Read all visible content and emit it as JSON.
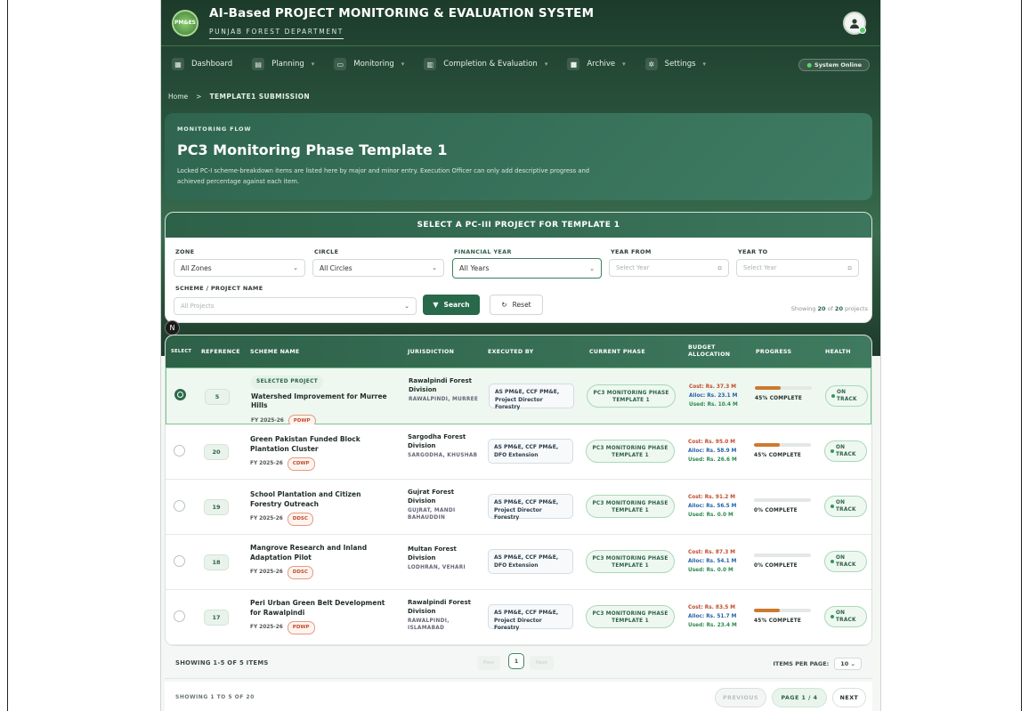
{
  "app": {
    "logo_text": "PM&ES",
    "title": "AI-Based PROJECT MONITORING & EVALUATION SYSTEM",
    "subtitle": "PUNJAB FOREST DEPARTMENT"
  },
  "nav": {
    "items": [
      {
        "label": "Dashboard",
        "icon": "grid-icon"
      },
      {
        "label": "Planning",
        "icon": "clipboard-icon"
      },
      {
        "label": "Monitoring",
        "icon": "monitor-icon"
      },
      {
        "label": "Completion & Evaluation",
        "icon": "chart-icon"
      },
      {
        "label": "Archive",
        "icon": "archive-icon"
      },
      {
        "label": "Settings",
        "icon": "gear-icon"
      }
    ],
    "status": "System Online"
  },
  "breadcrumb": {
    "home": "Home",
    "sep": ">",
    "current": "TEMPLATE1 SUBMISSION"
  },
  "hero": {
    "kicker": "MONITORING FLOW",
    "title": "PC3 Monitoring Phase Template 1",
    "description": "Locked PC-I scheme-breakdown items are listed here by major and minor entry. Execution Officer can only add descriptive progress and achieved percentage against each item."
  },
  "filters": {
    "header": "SELECT A PC-III PROJECT FOR TEMPLATE 1",
    "zone_label": "ZONE",
    "zone_value": "All Zones",
    "circle_label": "CIRCLE",
    "circle_value": "All Circles",
    "fy_label": "FINANCIAL YEAR",
    "fy_value": "All Years",
    "year_from_label": "YEAR FROM",
    "year_from_placeholder": "Select Year",
    "year_to_label": "YEAR TO",
    "year_to_placeholder": "Select Year",
    "scheme_label": "SCHEME / PROJECT NAME",
    "scheme_placeholder": "All Projects",
    "search_label": "Search",
    "reset_label": "Reset",
    "showing_prefix": "Showing",
    "showing_count": "20",
    "showing_of": "of",
    "showing_total": "20",
    "showing_suffix": "projects"
  },
  "table": {
    "headers": [
      "SELECT",
      "REFERENCE",
      "SCHEME NAME",
      "JURISDICTION",
      "EXECUTED BY",
      "CURRENT PHASE",
      "BUDGET ALLOCATION",
      "PROGRESS",
      "HEALTH"
    ],
    "selected_pill": "SELECTED PROJECT",
    "rows": [
      {
        "selected": true,
        "ref": "5",
        "name": "Watershed Improvement for Murree Hills",
        "fy": "FY 2025-26",
        "tag": "PDWP",
        "jur": "Rawalpindi Forest Division",
        "jur_sub": "RAWALPINDI, MURREE",
        "exec": "AS PM&E, CCF PM&E, Project Director Forestry",
        "phase": "PC3 MONITORING PHASE TEMPLATE 1",
        "cost": "Cost: Rs. 37.3 M",
        "alloc": "Alloc: Rs. 23.1 M",
        "used": "Used: Rs. 10.4 M",
        "progress": 45,
        "progress_text": "45% COMPLETE",
        "health": "ON TRACK"
      },
      {
        "selected": false,
        "ref": "20",
        "name": "Green Pakistan Funded Block Plantation Cluster",
        "fy": "FY 2025-26",
        "tag": "CDWP",
        "jur": "Sargodha Forest Division",
        "jur_sub": "SARGODHA, KHUSHAB",
        "exec": "AS PM&E, CCF PM&E, DFO Extension",
        "phase": "PC3 MONITORING PHASE TEMPLATE 1",
        "cost": "Cost: Rs. 95.0 M",
        "alloc": "Alloc: Rs. 58.9 M",
        "used": "Used: Rs. 26.6 M",
        "progress": 45,
        "progress_text": "45% COMPLETE",
        "health": "ON TRACK"
      },
      {
        "selected": false,
        "ref": "19",
        "name": "School Plantation and Citizen Forestry Outreach",
        "fy": "FY 2025-26",
        "tag": "DDSC",
        "jur": "Gujrat Forest Division",
        "jur_sub": "GUJRAT, MANDI BAHAUDDIN",
        "exec": "AS PM&E, CCF PM&E, Project Director Forestry",
        "phase": "PC3 MONITORING PHASE TEMPLATE 1",
        "cost": "Cost: Rs. 91.2 M",
        "alloc": "Alloc: Rs. 56.5 M",
        "used": "Used: Rs. 0.0 M",
        "progress": 0,
        "progress_text": "0% COMPLETE",
        "health": "ON TRACK"
      },
      {
        "selected": false,
        "ref": "18",
        "name": "Mangrove Research and Inland Adaptation Pilot",
        "fy": "FY 2025-26",
        "tag": "DDSC",
        "jur": "Multan Forest Division",
        "jur_sub": "LODHRAN, VEHARI",
        "exec": "AS PM&E, CCF PM&E, DFO Extension",
        "phase": "PC3 MONITORING PHASE TEMPLATE 1",
        "cost": "Cost: Rs. 87.3 M",
        "alloc": "Alloc: Rs. 54.1 M",
        "used": "Used: Rs. 0.0 M",
        "progress": 0,
        "progress_text": "0% COMPLETE",
        "health": "ON TRACK"
      },
      {
        "selected": false,
        "ref": "17",
        "name": "Peri Urban Green Belt Development for Rawalpindi",
        "fy": "FY 2025-26",
        "tag": "PDWP",
        "jur": "Rawalpindi Forest Division",
        "jur_sub": "RAWALPINDI, ISLAMABAD",
        "exec": "AS PM&E, CCF PM&E, Project Director Forestry",
        "phase": "PC3 MONITORING PHASE TEMPLATE 1",
        "cost": "Cost: Rs. 83.5 M",
        "alloc": "Alloc: Rs. 51.7 M",
        "used": "Used: Rs. 23.4 M",
        "progress": 45,
        "progress_text": "45% COMPLETE",
        "health": "ON TRACK"
      }
    ]
  },
  "pagination": {
    "items_text": "SHOWING 1-5 OF 5 ITEMS",
    "prev": "Prev",
    "current": "1",
    "next": "Next",
    "ipp_label": "ITEMS PER PAGE:",
    "ipp_value": "10",
    "projects_text": "SHOWING 1 TO 5 OF 20",
    "previous_btn": "PREVIOUS",
    "page_info": "PAGE 1 / 4",
    "next_btn": "NEXT"
  },
  "colors": {
    "brand": "#2d6148",
    "accent_orange": "#cc7a2e",
    "tag_red": "#c24c2a"
  }
}
